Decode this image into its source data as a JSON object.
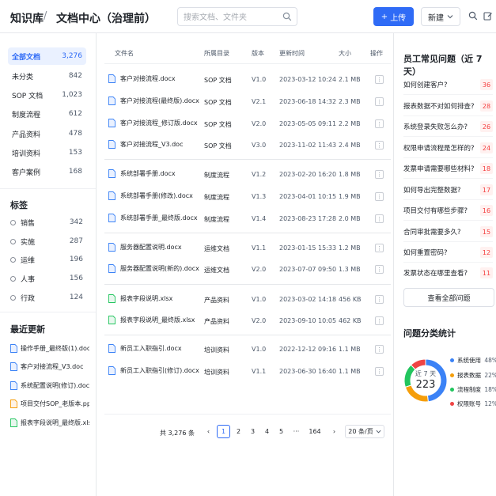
{
  "header": {
    "brand": "知识库",
    "separator": "/",
    "breadcrumb": "文档中心（治理前）",
    "search_placeholder": "搜索文档、文件夹",
    "upload_label": "上传",
    "new_label": "新建"
  },
  "sidebar": {
    "categories": [
      {
        "label": "全部文档",
        "count": "3,276"
      },
      {
        "label": "未分类",
        "count": "842"
      },
      {
        "label": "SOP 文档",
        "count": "1,023"
      },
      {
        "label": "制度流程",
        "count": "612"
      },
      {
        "label": "产品资料",
        "count": "478"
      },
      {
        "label": "培训资料",
        "count": "153"
      },
      {
        "label": "客户案例",
        "count": "168"
      }
    ],
    "tags_title": "标签",
    "tags": [
      {
        "label": "销售",
        "count": "342"
      },
      {
        "label": "实施",
        "count": "287"
      },
      {
        "label": "运维",
        "count": "196"
      },
      {
        "label": "人事",
        "count": "156"
      },
      {
        "label": "行政",
        "count": "124"
      }
    ],
    "recent_title": "最近更新",
    "recent": [
      {
        "label": "操作手册_最终版(1).docx",
        "type": "doc"
      },
      {
        "label": "客户对接流程_V3.doc",
        "type": "doc"
      },
      {
        "label": "系统配置说明(修订).docx",
        "type": "doc"
      },
      {
        "label": "项目交付SOP_老版本.pptx",
        "type": "ppt"
      },
      {
        "label": "报表字段说明_最终版.xlsx",
        "type": "xls"
      }
    ]
  },
  "table": {
    "headers": {
      "name": "文件名",
      "dir": "所属目录",
      "version": "版本",
      "updated": "更新时间",
      "size": "大小",
      "action": "操作"
    },
    "rows": [
      {
        "name": "客户对接流程.docx",
        "dir": "SOP 文档",
        "version": "V1.0",
        "updated": "2023-03-12 10:24",
        "size": "2.1 MB",
        "type": "doc"
      },
      {
        "name": "客户对接流程(最终版).docx",
        "dir": "SOP 文档",
        "version": "V2.1",
        "updated": "2023-06-18 14:32",
        "size": "2.3 MB",
        "type": "doc"
      },
      {
        "name": "客户对接流程_修订版.docx",
        "dir": "SOP 文档",
        "version": "V2.0",
        "updated": "2023-05-05 09:11",
        "size": "2.2 MB",
        "type": "doc"
      },
      {
        "name": "客户对接流程_V3.doc",
        "dir": "SOP 文档",
        "version": "V3.0",
        "updated": "2023-11-02 11:43",
        "size": "2.4 MB",
        "type": "doc"
      },
      {
        "name": "系统部署手册.docx",
        "dir": "制度流程",
        "version": "V1.2",
        "updated": "2023-02-20 16:20",
        "size": "1.8 MB",
        "type": "doc"
      },
      {
        "name": "系统部署手册(修改).docx",
        "dir": "制度流程",
        "version": "V1.3",
        "updated": "2023-04-01 10:15",
        "size": "1.9 MB",
        "type": "doc"
      },
      {
        "name": "系统部署手册_最终版.docx",
        "dir": "制度流程",
        "version": "V1.4",
        "updated": "2023-08-23 17:28",
        "size": "2.0 MB",
        "type": "doc"
      },
      {
        "name": "服务器配置说明.docx",
        "dir": "运维文档",
        "version": "V1.1",
        "updated": "2023-01-15 15:33",
        "size": "1.2 MB",
        "type": "doc"
      },
      {
        "name": "服务器配置说明(新的).docx",
        "dir": "运维文档",
        "version": "V2.0",
        "updated": "2023-07-07 09:50",
        "size": "1.3 MB",
        "type": "doc"
      },
      {
        "name": "报表字段说明.xlsx",
        "dir": "产品资料",
        "version": "V1.0",
        "updated": "2023-03-02 14:18",
        "size": "456 KB",
        "type": "xls"
      },
      {
        "name": "报表字段说明_最终版.xlsx",
        "dir": "产品资料",
        "version": "V2.0",
        "updated": "2023-09-10 10:05",
        "size": "462 KB",
        "type": "xls"
      },
      {
        "name": "新员工入职指引.docx",
        "dir": "培训资料",
        "version": "V1.0",
        "updated": "2022-12-12 09:16",
        "size": "1.1 MB",
        "type": "doc"
      },
      {
        "name": "新员工入职指引(修订).docx",
        "dir": "培训资料",
        "version": "V1.1",
        "updated": "2023-06-30 16:40",
        "size": "1.1 MB",
        "type": "doc"
      }
    ]
  },
  "pagination": {
    "total": "共 3,276 条",
    "prev": "‹",
    "pages": [
      "1",
      "2",
      "3",
      "4",
      "5"
    ],
    "ellipsis": "···",
    "last": "164",
    "next": "›",
    "page_size": "20 条/页"
  },
  "faq": {
    "title": "员工常见问题（近 7 天）",
    "items": [
      {
        "q": "如何创建客户?",
        "count": "36"
      },
      {
        "q": "报表数据不对如何排查?",
        "count": "28"
      },
      {
        "q": "系统登录失败怎么办?",
        "count": "26"
      },
      {
        "q": "权限申请流程是怎样的?",
        "count": "24"
      },
      {
        "q": "发票申请需要哪些材料?",
        "count": "18"
      },
      {
        "q": "如何导出完整数据?",
        "count": "17"
      },
      {
        "q": "项目交付有哪些步骤?",
        "count": "16"
      },
      {
        "q": "合同审批需要多久?",
        "count": "15"
      },
      {
        "q": "如何重置密码?",
        "count": "12"
      },
      {
        "q": "发票状态在哪里查看?",
        "count": "11"
      }
    ],
    "view_all": "查看全部问题"
  },
  "stats": {
    "title": "问题分类统计",
    "center_label": "近 7 天",
    "center_value": "223"
  },
  "chart_data": {
    "type": "pie",
    "categories": [
      "系统使用",
      "报表数据",
      "流程制度",
      "权限账号"
    ],
    "values": [
      48,
      22,
      18,
      12
    ],
    "value_labels": [
      "48%",
      "22%",
      "18%",
      "12%"
    ],
    "colors": [
      "#3b82f6",
      "#f59e0b",
      "#22c55e",
      "#ef4444"
    ],
    "legend_position": "right"
  }
}
